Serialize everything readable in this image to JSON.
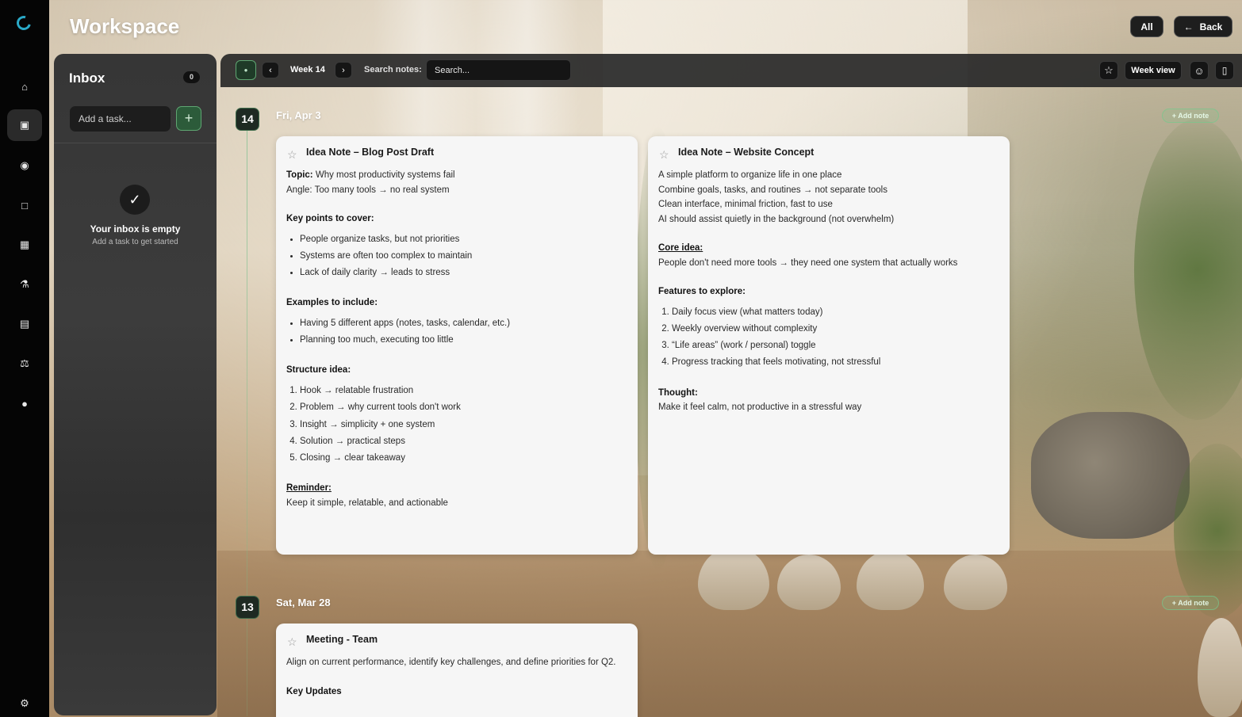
{
  "app": {
    "title": "Workspace",
    "filter_all": "All",
    "back_label": "Back"
  },
  "rail": {
    "items": [
      "home-icon",
      "inbox-tray-icon",
      "target-icon",
      "square-icon",
      "calendar-icon",
      "flask-icon",
      "notes-page-icon",
      "scale-icon",
      "chat-bubble-icon"
    ],
    "active_index": 1,
    "settings": "gear-icon"
  },
  "inbox": {
    "title": "Inbox",
    "count": "0",
    "add_placeholder": "Add a task...",
    "add_button": "+",
    "empty_icon": "✓",
    "empty_title": "Your inbox is empty",
    "empty_subtitle": "Add a task to get started"
  },
  "toolbar": {
    "week_label": "Week 14",
    "search_label": "Search notes:",
    "search_placeholder": "Search...",
    "view_label": "Week view"
  },
  "days": [
    {
      "badge": "14",
      "label": "Fri, Apr 3",
      "add_note": "+ Add note",
      "notes": [
        {
          "title": "Idea Note – Blog Post Draft",
          "topic_label": "Topic:",
          "topic": "Why most productivity systems fail",
          "angle": "Angle: Too many tools → no real system",
          "key_points_heading": "Key points to cover:",
          "key_points": [
            "People organize tasks, but not priorities",
            "Systems are often too complex to maintain",
            "Lack of daily clarity → leads to stress"
          ],
          "examples_heading": "Examples to include:",
          "examples": [
            "Having 5 different apps (notes, tasks, calendar, etc.)",
            "Planning too much, executing too little"
          ],
          "structure_heading": "Structure idea:",
          "structure": [
            "Hook → relatable frustration",
            "Problem → why current tools don't work",
            "Insight → simplicity + one system",
            "Solution → practical steps",
            "Closing → clear takeaway"
          ],
          "reminder_heading": "Reminder:",
          "reminder": "Keep it simple, relatable, and actionable"
        },
        {
          "title": "Idea Note – Website Concept",
          "intro": [
            "A simple platform to organize life in one place",
            "Combine goals, tasks, and routines → not separate tools",
            "Clean interface, minimal friction, fast to use",
            "AI should assist quietly in the background (not overwhelm)"
          ],
          "core_heading": "Core idea:",
          "core": "People don't need more tools → they need one system that actually works",
          "features_heading": "Features to explore:",
          "features": [
            "Daily focus view (what matters today)",
            "Weekly overview without complexity",
            "“Life areas” (work / personal) toggle",
            "Progress tracking that feels motivating, not stressful"
          ],
          "thought_heading": "Thought:",
          "thought": "Make it feel calm, not productive in a stressful way"
        }
      ]
    },
    {
      "badge": "13",
      "label": "Sat, Mar 28",
      "add_note": "+ Add note",
      "notes": [
        {
          "title": "Meeting - Team",
          "text": "Align on current performance, identify key challenges, and define priorities for Q2.",
          "updates_heading": "Key Updates"
        }
      ]
    }
  ]
}
